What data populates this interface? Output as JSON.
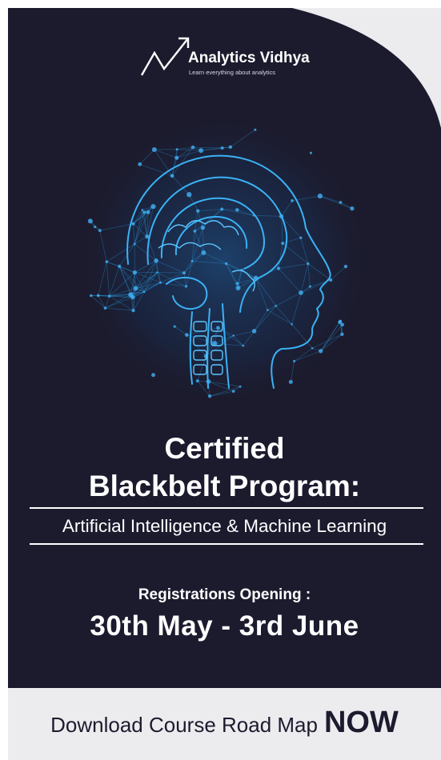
{
  "logo": {
    "name": "Analytics Vidhya",
    "tagline": "Learn everything about analytics"
  },
  "hero": {
    "illustration": "ai-brain-network-illustration",
    "title_line1": "Certified",
    "title_line2": "Blackbelt Program:",
    "subtitle": "Artificial Intelligence & Machine Learning"
  },
  "registration": {
    "label": "Registrations Opening :",
    "dates": "30th May - 3rd June"
  },
  "cta": {
    "text": "Download Course Road Map",
    "emphasis": "NOW"
  },
  "colors": {
    "navy": "#1c1b2e",
    "light_gray": "#ececef",
    "glow_blue": "#2aa3ec",
    "text": "#ffffff"
  }
}
